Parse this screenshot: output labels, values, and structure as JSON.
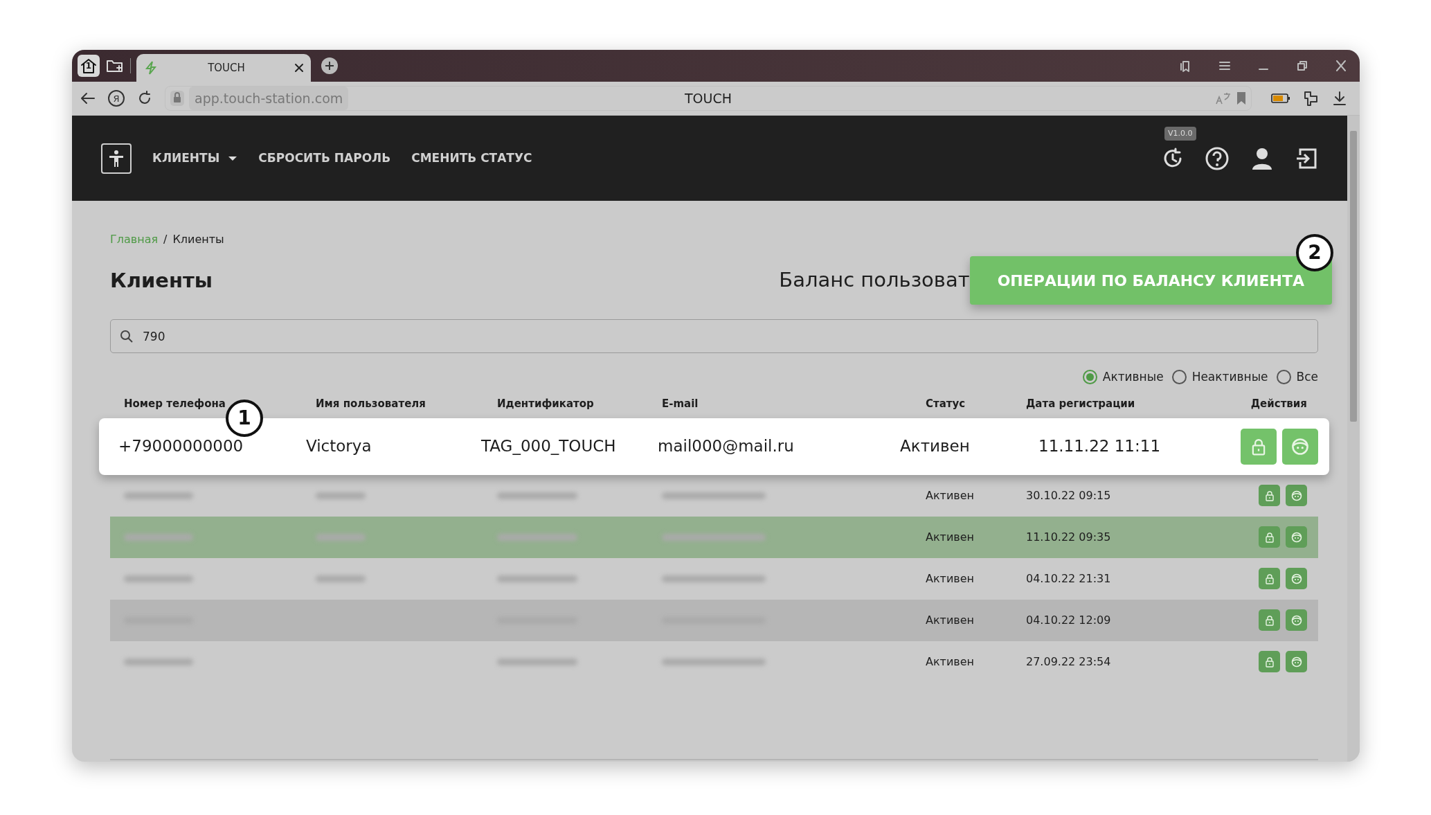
{
  "browser": {
    "tab_count": "1",
    "tabs": [
      {
        "title": "TOUCH",
        "selected": true
      }
    ],
    "logo_letter": "Я",
    "address": "app.touch-station.com",
    "page_title": "TOUCH"
  },
  "navbar": {
    "menu": [
      {
        "label": "КЛИЕНТЫ",
        "dropdown": true
      },
      {
        "label": "СБРОСИТЬ ПАРОЛЬ",
        "dropdown": false
      },
      {
        "label": "СМЕНИТЬ СТАТУС",
        "dropdown": false
      }
    ],
    "version": "V1.0.0"
  },
  "breadcrumb_separator": "/",
  "breadcrumbs": [
    {
      "label": "Главная",
      "link": true
    },
    {
      "label": "Клиенты",
      "link": false
    }
  ],
  "title": "Клиенты",
  "balance_text": "Баланс пользоват",
  "balance_button": "ОПЕРАЦИИ ПО БАЛАНСУ КЛИЕНТА",
  "search": {
    "value": "790"
  },
  "filters": [
    {
      "label": "Активные",
      "selected": true
    },
    {
      "label": "Неактивные",
      "selected": false
    },
    {
      "label": "Все",
      "selected": false
    }
  ],
  "table": {
    "columns": [
      "Номер телефона",
      "Имя пользователя",
      "Идентификатор",
      "E-mail",
      "Статус",
      "Дата регистрации",
      "Действия"
    ],
    "rows": [
      {
        "focused": true,
        "selected": false,
        "hovered": false,
        "phone": "+79000000000",
        "name": "Victorya",
        "id": "TAG_000_TOUCH",
        "email": "mail000@mail.ru",
        "status": "Активен",
        "date": "11.11.22 11:11"
      },
      {
        "focused": false,
        "selected": false,
        "hovered": false,
        "redacted": {
          "phone": true,
          "name": true,
          "id": true,
          "email": true
        },
        "status": "Активен",
        "date": "30.10.22 09:15"
      },
      {
        "focused": false,
        "selected": true,
        "hovered": false,
        "redacted": {
          "phone": true,
          "name": true,
          "id": true,
          "email": true
        },
        "status": "Активен",
        "date": "11.10.22 09:35"
      },
      {
        "focused": false,
        "selected": false,
        "hovered": false,
        "redacted": {
          "phone": true,
          "name": true,
          "id": true,
          "email": true
        },
        "status": "Активен",
        "date": "04.10.22 21:31"
      },
      {
        "focused": false,
        "selected": false,
        "hovered": true,
        "redacted": {
          "phone": true,
          "name": false,
          "id": true,
          "email": true
        },
        "status": "Активен",
        "date": "04.10.22 12:09"
      },
      {
        "focused": false,
        "selected": false,
        "hovered": false,
        "redacted": {
          "phone": true,
          "name": false,
          "id": true,
          "email": true
        },
        "status": "Активен",
        "date": "27.09.22 23:54"
      }
    ]
  },
  "callouts": [
    "1",
    "2"
  ]
}
